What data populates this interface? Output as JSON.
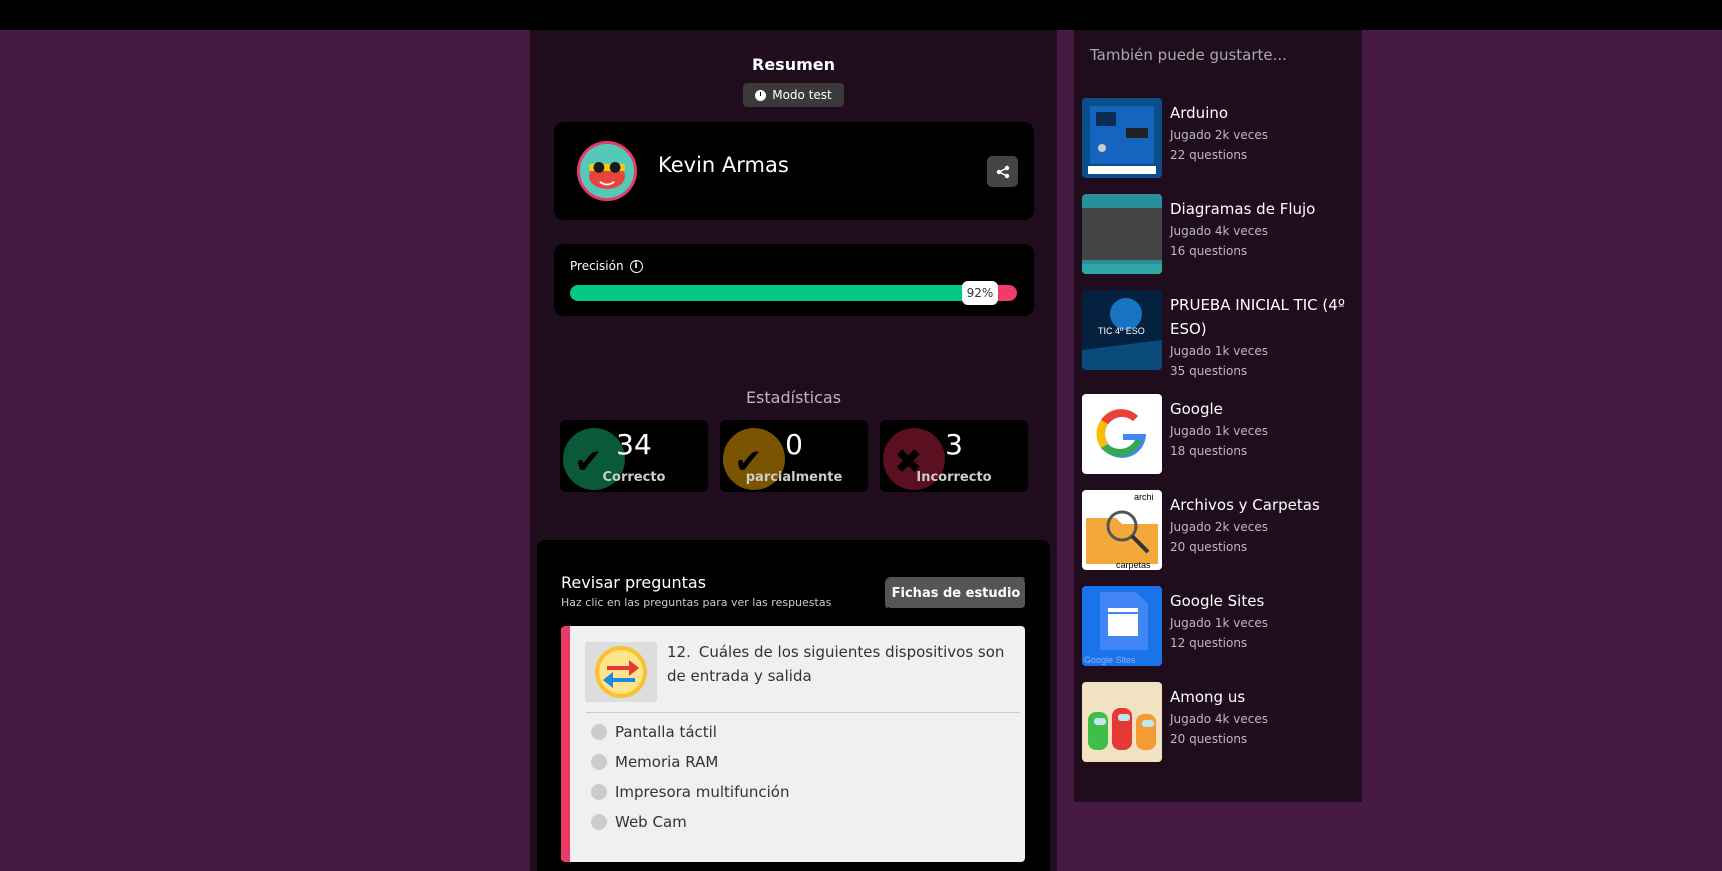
{
  "summary": {
    "title": "Resumen",
    "mode": "Modo test"
  },
  "player": {
    "name": "Kevin Armas"
  },
  "precision": {
    "label": "Precisión",
    "percent_label": "92%",
    "percent": 92
  },
  "stats": {
    "title": "Estadísticas",
    "items": [
      {
        "value": "34",
        "label": "Correcto",
        "color": "#0a5a3a"
      },
      {
        "value": "0",
        "label": "parcialmente",
        "color": "#7a5400"
      },
      {
        "value": "3",
        "label": "Incorrecto",
        "color": "#5a1020"
      }
    ]
  },
  "review": {
    "title": "Revisar preguntas",
    "subtitle": "Haz clic en las preguntas para ver las respuestas",
    "flashcards_label": "Fichas de estudio",
    "question": {
      "number": "12.",
      "text": "Cuáles de los siguientes dispositivos son de entrada y salida",
      "options": [
        "Pantalla táctil",
        "Memoria RAM",
        "Impresora multifunción",
        "Web Cam"
      ]
    }
  },
  "sidebar": {
    "title": "También puede gustarte...",
    "items": [
      {
        "title": "Arduino",
        "plays": "Jugado 2k veces",
        "questions": "22 questions"
      },
      {
        "title": "Diagramas de Flujo",
        "plays": "Jugado 4k veces",
        "questions": "16 questions"
      },
      {
        "title": "PRUEBA INICIAL TIC (4º ESO)",
        "plays": "Jugado 1k veces",
        "questions": "35 questions",
        "thumb_text": "TIC 4º ESO"
      },
      {
        "title": "Google",
        "plays": "Jugado 1k veces",
        "questions": "18 questions"
      },
      {
        "title": "Archivos y Carpetas",
        "plays": "Jugado 2k veces",
        "questions": "20 questions",
        "thumb_text_top": "archi",
        "thumb_text_bottom": "carpetas"
      },
      {
        "title": "Google Sites",
        "plays": "Jugado 1k veces",
        "questions": "12 questions",
        "thumb_text": "Google Sites"
      },
      {
        "title": "Among us",
        "plays": "Jugado 4k veces",
        "questions": "20 questions"
      }
    ]
  },
  "colors": {
    "page_bg": "#461a42",
    "panel_bg": "#1f0c1d",
    "correct": "#00c985",
    "incorrect": "#ef3c68"
  }
}
